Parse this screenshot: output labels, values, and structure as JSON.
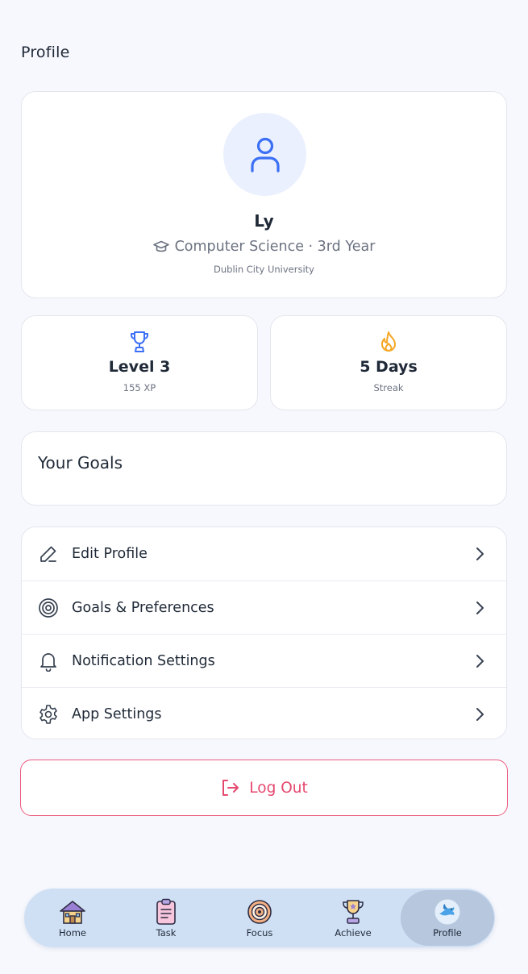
{
  "header": {
    "title": "Profile"
  },
  "profile": {
    "name": "Ly",
    "major": "Computer Science · 3rd Year",
    "university": "Dublin City University"
  },
  "stats": {
    "level": {
      "value": "Level 3",
      "label": "155 XP"
    },
    "streak": {
      "value": "5 Days",
      "label": "Streak"
    }
  },
  "goals": {
    "title": "Your Goals"
  },
  "menu": {
    "items": [
      {
        "label": "Edit Profile",
        "icon": "pencil-icon"
      },
      {
        "label": "Goals & Preferences",
        "icon": "target-icon"
      },
      {
        "label": "Notification Settings",
        "icon": "bell-icon"
      },
      {
        "label": "App Settings",
        "icon": "gear-icon"
      }
    ]
  },
  "logout": {
    "label": "Log Out"
  },
  "nav": {
    "items": [
      {
        "label": "Home",
        "icon": "house-icon"
      },
      {
        "label": "Task",
        "icon": "clipboard-icon"
      },
      {
        "label": "Focus",
        "icon": "target-icon"
      },
      {
        "label": "Achieve",
        "icon": "trophy-icon"
      },
      {
        "label": "Profile",
        "icon": "bird-icon"
      }
    ],
    "active": "Profile"
  },
  "colors": {
    "accent_blue": "#3b6ff5",
    "streak_orange": "#f5a623",
    "logout_red": "#e5486f",
    "nav_bg": "#cfe0f5"
  }
}
